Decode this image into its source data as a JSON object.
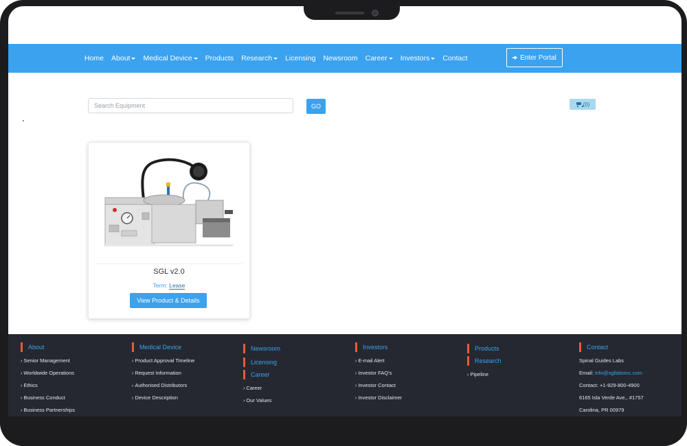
{
  "nav": {
    "items": [
      {
        "label": "Home",
        "dropdown": false
      },
      {
        "label": "About",
        "dropdown": true
      },
      {
        "label": "Medical Device",
        "dropdown": true
      },
      {
        "label": "Products",
        "dropdown": false
      },
      {
        "label": "Research",
        "dropdown": true
      },
      {
        "label": "Licensing",
        "dropdown": false
      },
      {
        "label": "Newsroom",
        "dropdown": false
      },
      {
        "label": "Career",
        "dropdown": true
      },
      {
        "label": "Investors",
        "dropdown": true
      },
      {
        "label": "Contact",
        "dropdown": false
      }
    ],
    "portal_label": "Enter Portal"
  },
  "search": {
    "placeholder": "Search Equipment",
    "go_label": "GO",
    "cart_label": "(0)"
  },
  "product": {
    "name": "SGL v2.0",
    "term_label": "Term:",
    "term_value": "Lease",
    "button_label": "View Product & Details"
  },
  "footer": {
    "about": {
      "title": "About",
      "links": [
        "Senior Management",
        "Worldwide Operations",
        "Ethics",
        "Business Conduct",
        "Business Partnerships"
      ]
    },
    "medical_device": {
      "title": "Medical Device",
      "links": [
        "Product Approval Timeline",
        "Request Information",
        "Authorised Distributors",
        "Device Description"
      ]
    },
    "newsroom": {
      "title": "Newsroom"
    },
    "licensing": {
      "title": "Licensing"
    },
    "career": {
      "title": "Career",
      "links": [
        "Career",
        "Our Values"
      ]
    },
    "investors": {
      "title": "Investors",
      "links": [
        "E-mail Alert",
        "Investor FAQ's",
        "Investor Contact",
        "Investor Disclaimer"
      ]
    },
    "products": {
      "title": "Products"
    },
    "research": {
      "title": "Research",
      "links": [
        "Pipeline"
      ]
    },
    "contact": {
      "title": "Contact",
      "company": "Spinal Guides Labs",
      "email_label": "Email:",
      "email": "info@sgllabsinc.com",
      "phone": "Contact: +1-929-800-4900",
      "address1": "6165 Isla Verde Ave., #1757",
      "address2": "Carolina, PR 00979"
    }
  },
  "colors": {
    "primary": "#3aa2ee",
    "footer_bg": "#252830",
    "footer_accent": "#e8593d"
  }
}
